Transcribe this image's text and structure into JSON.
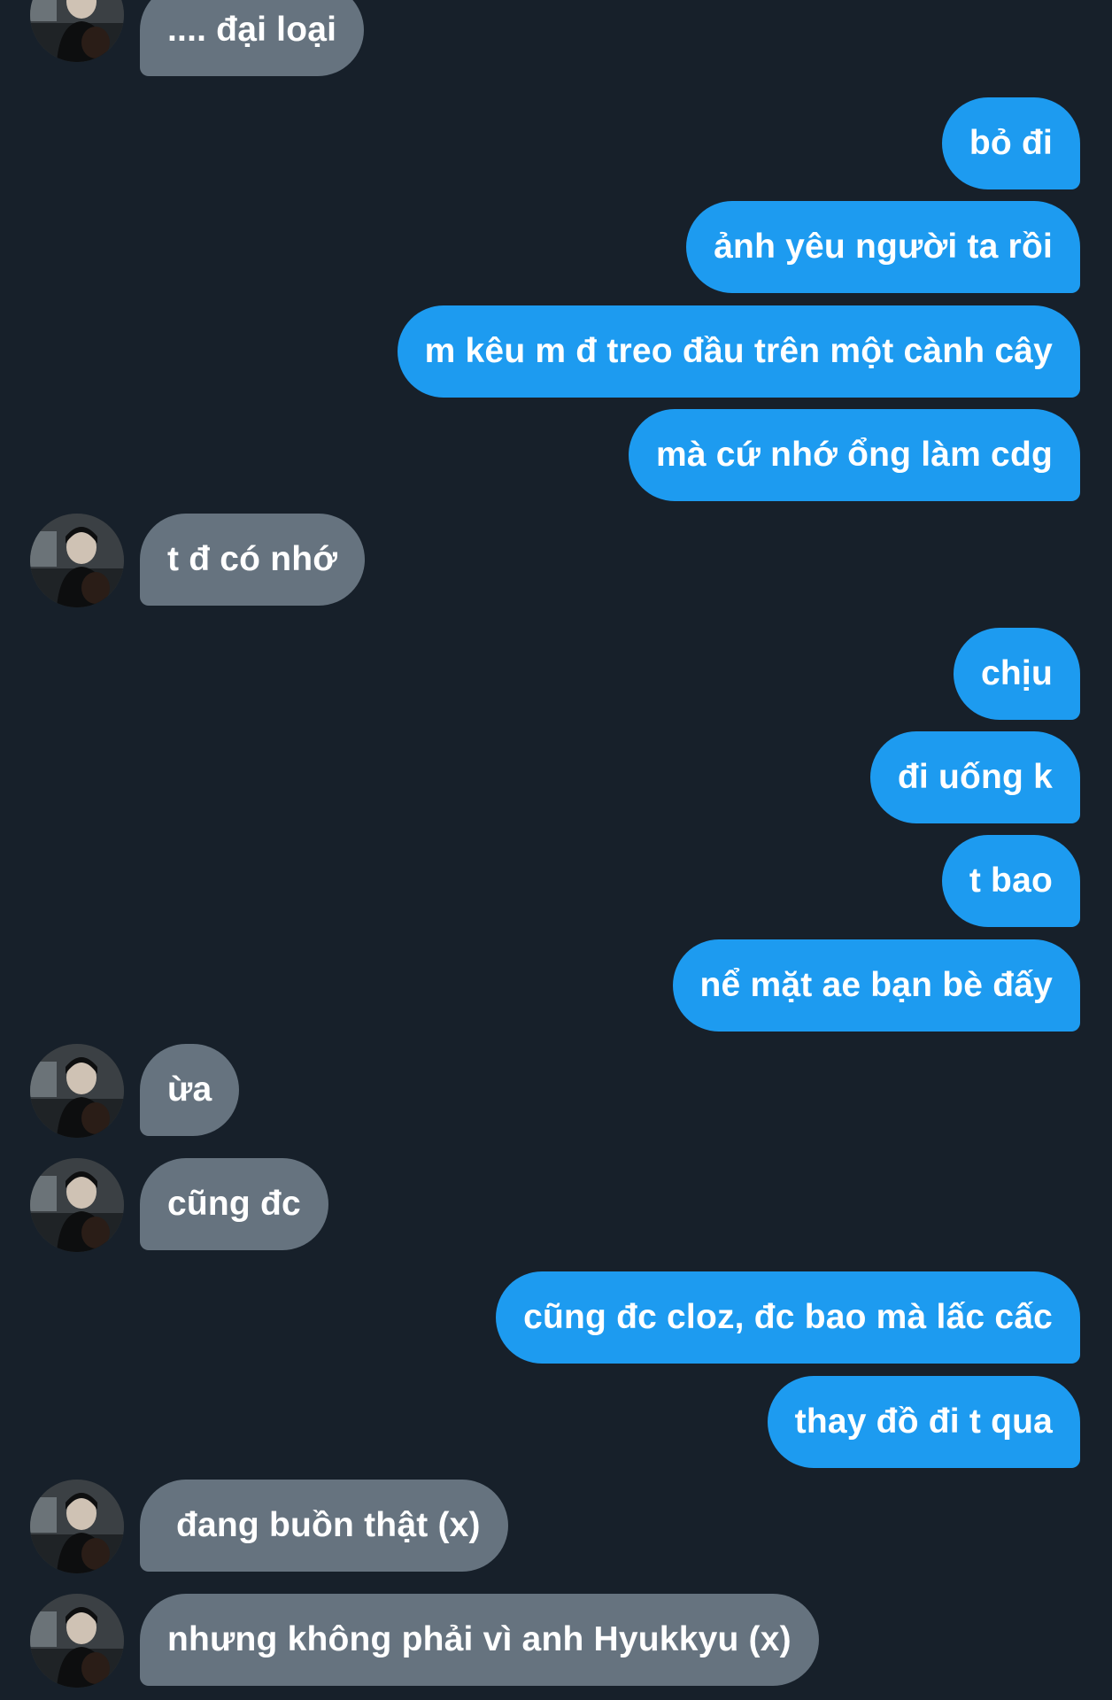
{
  "conversation": {
    "messages": [
      {
        "sender": "other",
        "text": ".... đại loại"
      },
      {
        "sender": "me",
        "text": "bỏ đi"
      },
      {
        "sender": "me",
        "text": "ảnh yêu người ta rồi"
      },
      {
        "sender": "me",
        "text": "m kêu m đ treo đầu trên một cành cây"
      },
      {
        "sender": "me",
        "text": "mà cứ nhớ ổng làm cdg"
      },
      {
        "sender": "other",
        "text": "t đ có nhớ"
      },
      {
        "sender": "me",
        "text": "chịu"
      },
      {
        "sender": "me",
        "text": "đi uống k"
      },
      {
        "sender": "me",
        "text": "t bao"
      },
      {
        "sender": "me",
        "text": "nể mặt ae bạn bè đấy"
      },
      {
        "sender": "other",
        "text": "ừa"
      },
      {
        "sender": "other",
        "text": "cũng đc"
      },
      {
        "sender": "me",
        "text": "cũng đc cloz, đc bao mà lấc cấc"
      },
      {
        "sender": "me",
        "text": "thay đồ đi t qua"
      },
      {
        "sender": "other",
        "text": "đang buồn thật (x)"
      },
      {
        "sender": "other",
        "text": "nhưng không phải vì anh Hyukkyu (x)"
      }
    ]
  },
  "colors": {
    "background": "#17202a",
    "outgoing_bubble": "#1d9bf0",
    "incoming_bubble": "#66737f",
    "text": "#ffffff"
  }
}
